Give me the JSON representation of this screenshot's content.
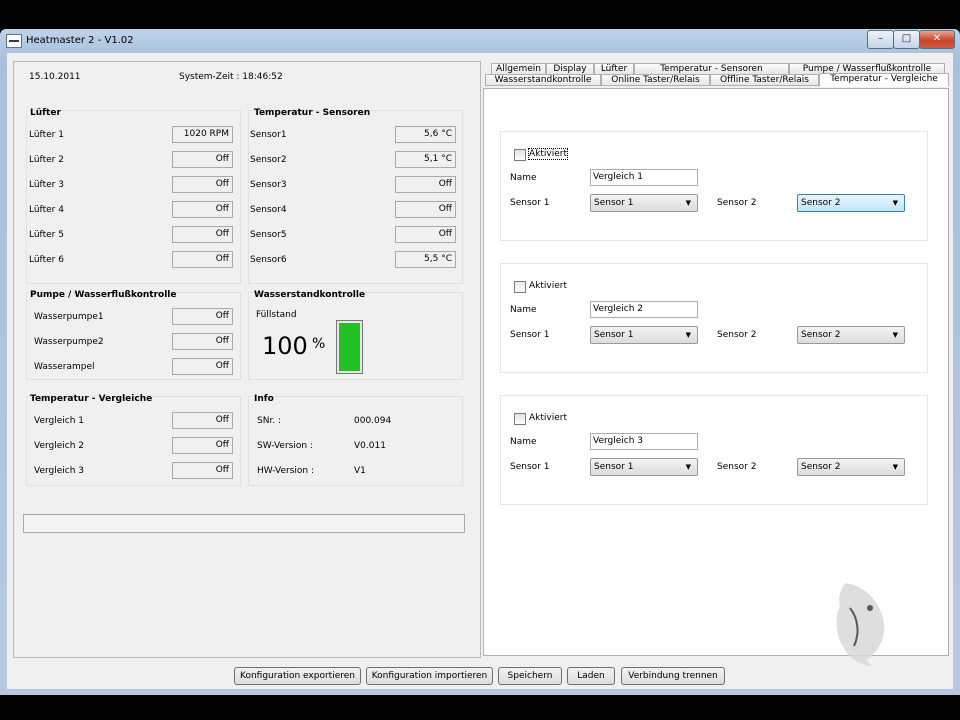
{
  "window": {
    "title": "Heatmaster 2 - V1.02",
    "min_glyph": "–",
    "max_glyph": "□",
    "close_glyph": "✕"
  },
  "header": {
    "date": "15.10.2011",
    "system_time": "System-Zeit : 18:46:52"
  },
  "luefter": {
    "title": "Lüfter",
    "rows": [
      {
        "label": "Lüfter 1",
        "value": "1020 RPM"
      },
      {
        "label": "Lüfter 2",
        "value": "Off"
      },
      {
        "label": "Lüfter 3",
        "value": "Off"
      },
      {
        "label": "Lüfter 4",
        "value": "Off"
      },
      {
        "label": "Lüfter 5",
        "value": "Off"
      },
      {
        "label": "Lüfter 6",
        "value": "Off"
      }
    ]
  },
  "temp_sensoren": {
    "title": "Temperatur - Sensoren",
    "rows": [
      {
        "label": "Sensor1",
        "value": "5,6 °C"
      },
      {
        "label": "Sensor2",
        "value": "5,1 °C"
      },
      {
        "label": "Sensor3",
        "value": "Off"
      },
      {
        "label": "Sensor4",
        "value": "Off"
      },
      {
        "label": "Sensor5",
        "value": "Off"
      },
      {
        "label": "Sensor6",
        "value": "5,5 °C"
      }
    ]
  },
  "pumpe": {
    "title": "Pumpe / Wasserflußkontrolle",
    "rows": [
      {
        "label": "Wasserpumpe1",
        "value": "Off"
      },
      {
        "label": "Wasserpumpe2",
        "value": "Off"
      },
      {
        "label": "Wasserampel",
        "value": "Off"
      }
    ]
  },
  "wasserstand": {
    "title": "Wasserstandkontrolle",
    "label": "Füllstand",
    "value": "100",
    "unit": "%",
    "level": 1.0,
    "level_color": "#22c022"
  },
  "vergleiche": {
    "title": "Temperatur - Vergleiche",
    "rows": [
      {
        "label": "Vergleich 1",
        "value": "Off"
      },
      {
        "label": "Vergleich 2",
        "value": "Off"
      },
      {
        "label": "Vergleich 3",
        "value": "Off"
      }
    ]
  },
  "info": {
    "title": "Info",
    "rows": [
      {
        "label": "SNr. :",
        "value": "000.094"
      },
      {
        "label": "SW-Version :",
        "value": "V0.011"
      },
      {
        "label": "HW-Version :",
        "value": "V1"
      }
    ]
  },
  "tabs": {
    "row1": [
      "Allgemein",
      "Display",
      "Lüfter",
      "Temperatur - Sensoren",
      "Pumpe / Wasserflußkontrolle"
    ],
    "row2": [
      "Wasserstandkontrolle",
      "Online Taster/Relais",
      "Offline Taster/Relais",
      "Temperatur - Vergleiche"
    ],
    "active": "Temperatur - Vergleiche"
  },
  "vergleich_config": [
    {
      "aktiviert_label": "Aktiviert",
      "aktiviert": false,
      "name_label": "Name",
      "name": "Vergleich 1",
      "sensor1_label": "Sensor 1",
      "sensor1": "Sensor 1",
      "sensor2_label": "Sensor 2",
      "sensor2": "Sensor 2"
    },
    {
      "aktiviert_label": "Aktiviert",
      "aktiviert": false,
      "name_label": "Name",
      "name": "Vergleich 2",
      "sensor1_label": "Sensor 1",
      "sensor1": "Sensor 1",
      "sensor2_label": "Sensor 2",
      "sensor2": "Sensor 2"
    },
    {
      "aktiviert_label": "Aktiviert",
      "aktiviert": false,
      "name_label": "Name",
      "name": "Vergleich 3",
      "sensor1_label": "Sensor 1",
      "sensor1": "Sensor 1",
      "sensor2_label": "Sensor 2",
      "sensor2": "Sensor 2"
    }
  ],
  "buttons": {
    "export": "Konfiguration exportieren",
    "import": "Konfiguration importieren",
    "save": "Speichern",
    "load": "Laden",
    "disconnect": "Verbindung trennen"
  },
  "icons": {
    "dropdown": "chevron-down-icon",
    "logo": "dolphin-logo"
  }
}
